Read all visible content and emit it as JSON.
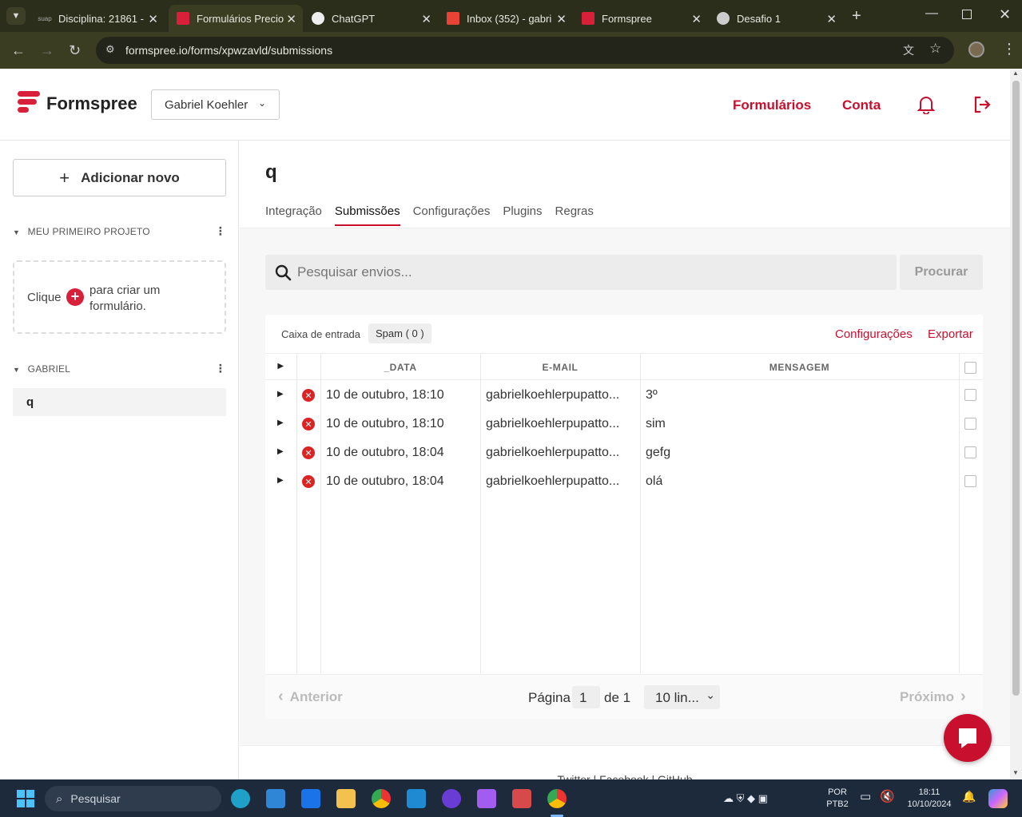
{
  "browser": {
    "tabs": [
      {
        "favicon": "suap",
        "title": "Disciplina: 21861 -",
        "active": false
      },
      {
        "favicon": "formspree-icon",
        "title": "Formulários Precio",
        "active": true
      },
      {
        "favicon": "chatgpt-icon",
        "title": "ChatGPT",
        "active": false
      },
      {
        "favicon": "gmail-icon",
        "title": "Inbox (352) - gabri",
        "active": false
      },
      {
        "favicon": "formspree-icon",
        "title": "Formspree",
        "active": false
      },
      {
        "favicon": "globe-icon",
        "title": "Desafio 1",
        "active": false
      }
    ],
    "url": "formspree.io/forms/xpwzavld/submissions"
  },
  "header": {
    "brand": "Formspree",
    "account": "Gabriel Koehler",
    "nav": [
      "Formulários",
      "Conta"
    ],
    "accent": "#c8102e"
  },
  "sidebar": {
    "add_new": "Adicionar novo",
    "project1": "MEU PRIMEIRO PROJETO",
    "empty_hint_a": "Clique",
    "empty_hint_b": "para criar um formulário.",
    "project2": "GABRIEL",
    "form_item": "q"
  },
  "form": {
    "title": "q",
    "tabs": [
      "Integração",
      "Submissões",
      "Configurações",
      "Plugins",
      "Regras"
    ],
    "active_tab": "Submissões",
    "search_placeholder": "Pesquisar envios...",
    "search_button": "Procurar",
    "inbox_label": "Caixa de entrada",
    "spam_label": "Spam ( 0 )",
    "settings_link": "Configurações",
    "export_link": "Exportar",
    "columns": [
      "_DATA",
      "E-MAIL",
      "MENSAGEM"
    ],
    "rows": [
      {
        "date": "10 de outubro, 18:10",
        "email": "gabrielkoehlerpupatto...",
        "message": "3º"
      },
      {
        "date": "10 de outubro, 18:10",
        "email": "gabrielkoehlerpupatto...",
        "message": "sim"
      },
      {
        "date": "10 de outubro, 18:04",
        "email": "gabrielkoehlerpupatto...",
        "message": "gefg"
      },
      {
        "date": "10 de outubro, 18:04",
        "email": "gabrielkoehlerpupatto...",
        "message": "olá"
      }
    ],
    "pager": {
      "prev": "Anterior",
      "page_label": "Página",
      "page": "1",
      "of": "de 1",
      "rows_select": "10 lin...",
      "next": "Próximo"
    }
  },
  "footer": "Twitter | Facebook | GitHub",
  "taskbar": {
    "search": "Pesquisar",
    "lang": "POR",
    "layout": "PTB2",
    "time": "18:11",
    "date": "10/10/2024"
  }
}
